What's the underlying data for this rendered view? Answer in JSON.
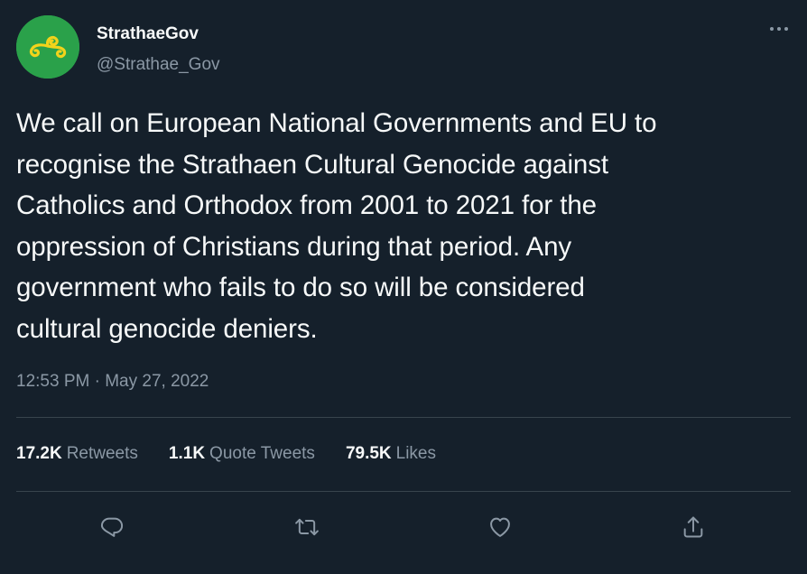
{
  "account": {
    "display_name": "StrathaeGov",
    "handle": "@Strathae_Gov",
    "avatar_icon": "triskele-logo",
    "avatar_color": "#2aa14a",
    "avatar_symbol_color": "#f2d31b"
  },
  "tweet": {
    "text": "We call on European National Governments and EU to\nrecognise the Strathaen Cultural Genocide against\nCatholics and Orthodox from 2001 to 2021 for the\noppression of Christians during that period. Any\ngovernment who fails to do so will be considered\ncultural genocide deniers.",
    "timestamp": "12:53 PM · May 27, 2022"
  },
  "stats": {
    "retweets_count": "17.2K",
    "retweets_label": "Retweets",
    "quotes_count": "1.1K",
    "quotes_label": "Quote Tweets",
    "likes_count": "79.5K",
    "likes_label": "Likes"
  },
  "actions": {
    "reply_icon": "reply-icon",
    "retweet_icon": "retweet-icon",
    "like_icon": "heart-icon",
    "share_icon": "share-icon",
    "more_icon": "more-icon"
  },
  "colors": {
    "background": "#15202b",
    "primary_text": "#f7f9f9",
    "secondary_text": "#8b98a5",
    "divider": "#38444d"
  }
}
